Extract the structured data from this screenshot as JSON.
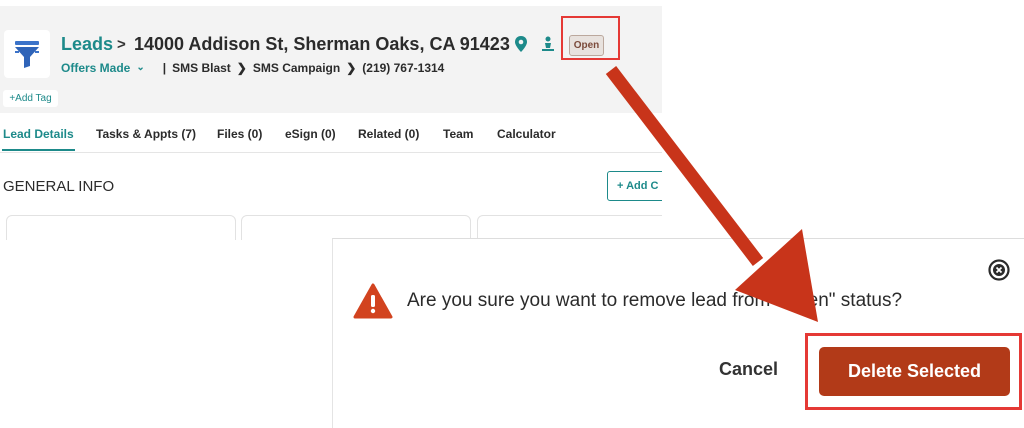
{
  "header": {
    "breadcrumb_root": "Leads",
    "breadcrumb_sep": ">",
    "address": "14000 Addison St, Sherman Oaks, CA 91423",
    "status_badge": "Open",
    "stage": "Offers Made",
    "sub_sep": "|",
    "source": "SMS Blast",
    "campaign": "SMS Campaign",
    "phone": "(219) 767-1314",
    "add_tag": "+Add Tag",
    "icons": [
      "location-pin-icon",
      "person-icon",
      "funnel-logo-icon"
    ]
  },
  "tabs": [
    {
      "label": "Lead Details",
      "active": true
    },
    {
      "label": "Tasks & Appts (7)",
      "active": false
    },
    {
      "label": "Files (0)",
      "active": false
    },
    {
      "label": "eSign (0)",
      "active": false
    },
    {
      "label": "Related (0)",
      "active": false
    },
    {
      "label": "Team",
      "active": false
    },
    {
      "label": "Calculator",
      "active": false
    }
  ],
  "section": {
    "title": "GENERAL INFO",
    "add_button": "+ Add C"
  },
  "dialog": {
    "message": "Are you sure you want to remove lead from \"Open\" status?",
    "cancel_label": "Cancel",
    "delete_label": "Delete Selected",
    "icons": [
      "warning-icon",
      "close-icon"
    ]
  },
  "colors": {
    "brand_teal": "#1d8a8a",
    "delete_button": "#b23a18",
    "highlight_red": "#e53935",
    "arrow": "#c8341a"
  }
}
